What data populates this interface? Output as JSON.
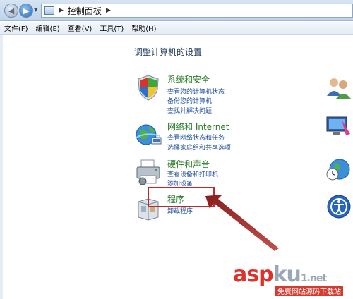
{
  "address_bar": {
    "breadcrumb": "控制面板"
  },
  "menu": [
    "文件(F)",
    "编辑(E)",
    "查看(V)",
    "工具(T)",
    "帮助(H)"
  ],
  "heading": "调整计算机的设置",
  "categories": [
    {
      "title": "系统和安全",
      "icon": "shield-icon",
      "links": [
        "查看您的计算机状态",
        "备份您的计算机",
        "查找并解决问题"
      ]
    },
    {
      "title": "网络和 Internet",
      "icon": "network-globe-icon",
      "links": [
        "查看网络状态和任务",
        "选择家庭组和共享选项"
      ]
    },
    {
      "title": "硬件和声音",
      "icon": "printer-icon",
      "links": [
        "查看设备和打印机",
        "添加设备"
      ]
    },
    {
      "title": "程序",
      "icon": "programs-box-icon",
      "links": [
        "卸载程序"
      ]
    }
  ],
  "watermark": {
    "main_a": "asp",
    "main_b": "ku",
    "suffix": "1.net",
    "sub": "免费网站源码下载站"
  },
  "colors": {
    "callout": "#c0272d",
    "category_title": "#2a7a2a",
    "link": "#1f4f9f"
  }
}
